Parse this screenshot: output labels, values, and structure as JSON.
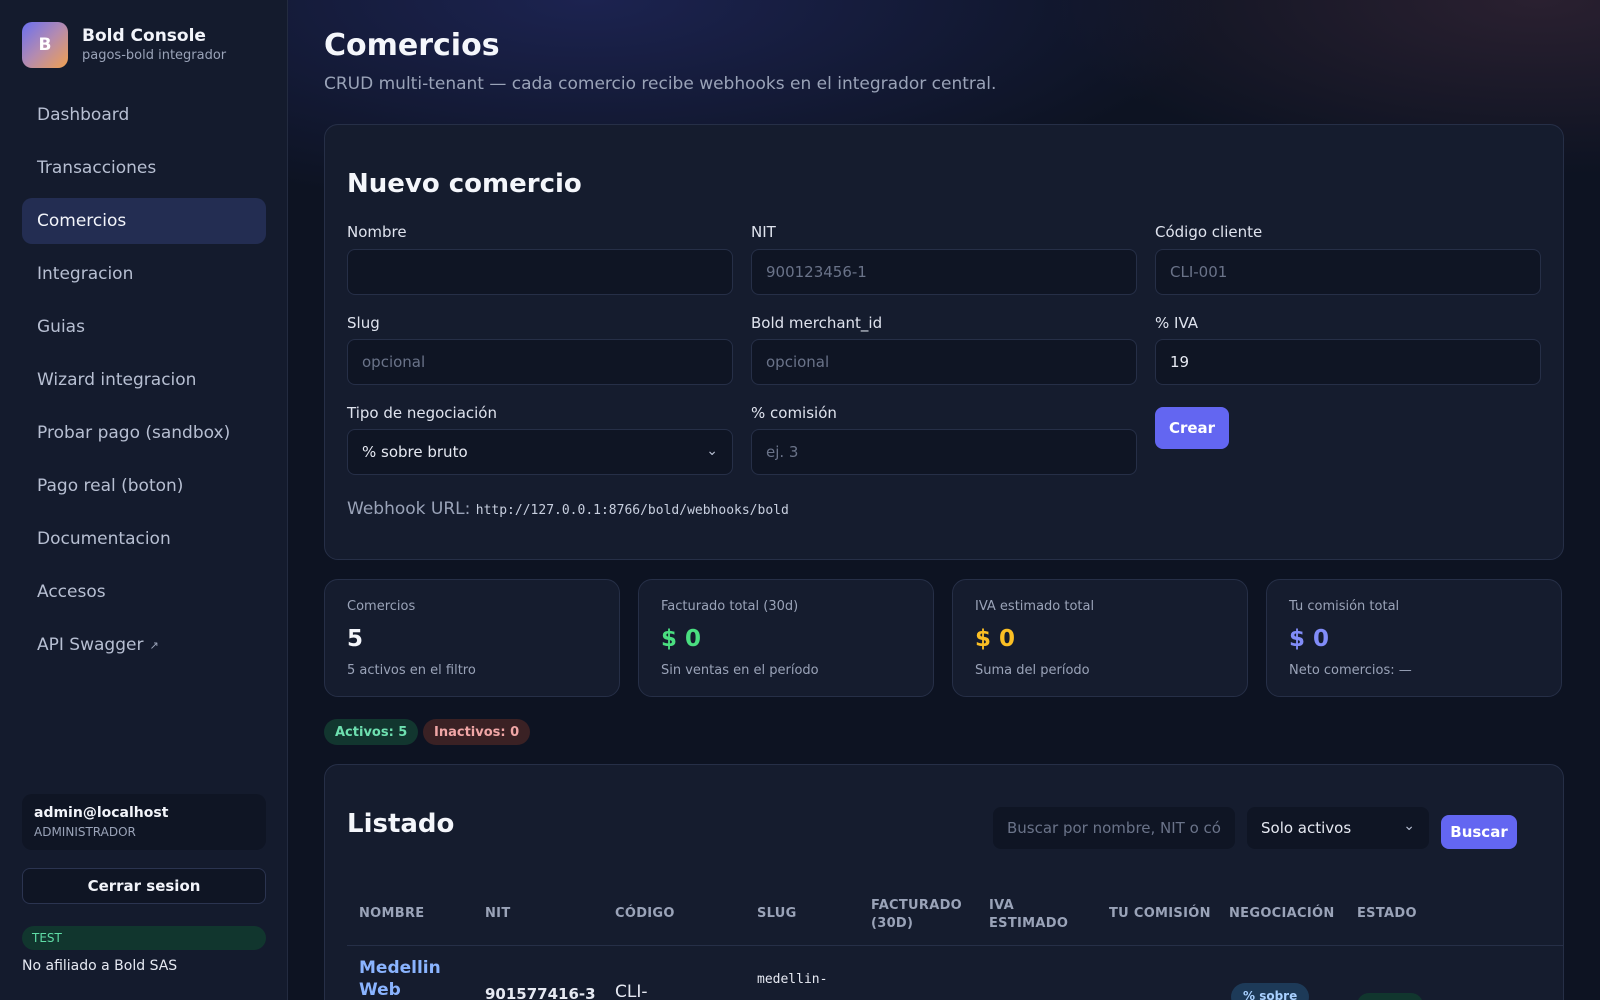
{
  "brand": {
    "logo_letter": "B",
    "title": "Bold Console",
    "subtitle": "pagos-bold integrador"
  },
  "nav": {
    "items": [
      {
        "label": "Dashboard"
      },
      {
        "label": "Transacciones"
      },
      {
        "label": "Comercios",
        "active": true
      },
      {
        "label": "Integracion"
      },
      {
        "label": "Guias"
      },
      {
        "label": "Wizard integracion"
      },
      {
        "label": "Probar pago (sandbox)"
      },
      {
        "label": "Pago real (boton)"
      },
      {
        "label": "Documentacion"
      },
      {
        "label": "Accesos"
      },
      {
        "label": "API Swagger",
        "icon": "external-link-icon"
      }
    ]
  },
  "user": {
    "email": "admin@localhost",
    "role": "ADMINISTRADOR",
    "logout_label": "Cerrar sesion",
    "env_badge": "TEST",
    "affiliation": "No afiliado a Bold SAS"
  },
  "page": {
    "title": "Comercios",
    "subtitle": "CRUD multi-tenant — cada comercio recibe webhooks en el integrador central."
  },
  "form": {
    "title": "Nuevo comercio",
    "fields": {
      "nombre": {
        "label": "Nombre",
        "value": "",
        "placeholder": ""
      },
      "nit": {
        "label": "NIT",
        "placeholder": "900123456-1"
      },
      "codigo": {
        "label": "Código cliente",
        "placeholder": "CLI-001"
      },
      "slug": {
        "label": "Slug",
        "placeholder": "opcional"
      },
      "merchant": {
        "label": "Bold merchant_id",
        "placeholder": "opcional"
      },
      "iva": {
        "label": "% IVA",
        "value": "19"
      },
      "tipo": {
        "label": "Tipo de negociación",
        "value": "% sobre bruto"
      },
      "comision": {
        "label": "% comisión",
        "placeholder": "ej. 3"
      }
    },
    "create_label": "Crear",
    "webhook_label": "Webhook URL:",
    "webhook_url": "http://127.0.0.1:8766/bold/webhooks/bold"
  },
  "stats": [
    {
      "label": "Comercios",
      "value": "5",
      "foot": "5 activos en el filtro",
      "color": "#f4f6fb"
    },
    {
      "label": "Facturado total (30d)",
      "value": "$ 0",
      "foot": "Sin ventas en el período",
      "color": "#4ade80"
    },
    {
      "label": "IVA estimado total",
      "value": "$ 0",
      "foot": "Suma del período",
      "color": "#fbbf24"
    },
    {
      "label": "Tu comisión total",
      "value": "$ 0",
      "foot": "Neto comercios: —",
      "color": "#818cf8"
    }
  ],
  "filters": {
    "active_pill": "Activos: 5",
    "inactive_pill": "Inactivos: 0"
  },
  "listing": {
    "title": "Listado",
    "search_placeholder": "Buscar por nombre, NIT o código",
    "status_select": "Solo activos",
    "search_button": "Buscar",
    "columns": [
      "NOMBRE",
      "NIT",
      "CÓDIGO",
      "SLUG",
      "FACTURADO (30D)",
      "IVA ESTIMADO",
      "TU COMISIÓN",
      "NEGOCIACIÓN",
      "ESTADO"
    ],
    "rows": [
      {
        "nombre": "Medellin Web",
        "nit": "901577416-3",
        "codigo": "CLI-",
        "slug": "medellin-",
        "negociacion": "% sobre"
      }
    ]
  }
}
